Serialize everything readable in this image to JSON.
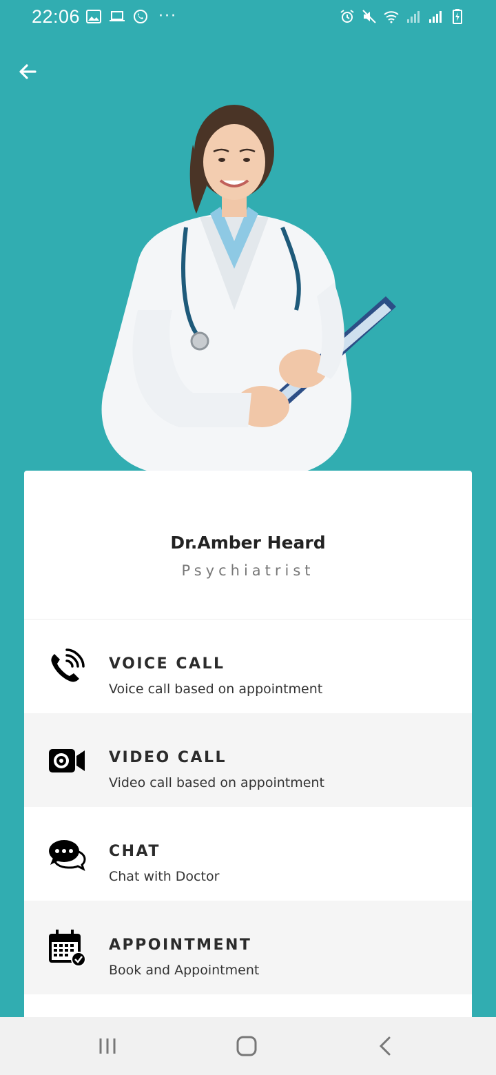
{
  "status_bar": {
    "time": "22:06",
    "left_icons": [
      "image-icon",
      "laptop-icon",
      "whatsapp-icon",
      "more-dots-icon"
    ],
    "right_icons": [
      "alarm-icon",
      "mute-icon",
      "wifi-icon",
      "signal-icon",
      "signal-icon",
      "battery-charging-icon"
    ],
    "more_dots": "···"
  },
  "header": {
    "back_icon": "arrow-left-icon"
  },
  "doctor": {
    "name": "Dr.Amber Heard",
    "specialty": "Psychiatrist"
  },
  "options": [
    {
      "title": "VOICE CALL",
      "subtitle": "Voice call based on appointment",
      "icon": "phone-call-icon"
    },
    {
      "title": "VIDEO CALL",
      "subtitle": "Video call based on appointment",
      "icon": "video-camera-icon"
    },
    {
      "title": "CHAT",
      "subtitle": "Chat with Doctor",
      "icon": "chat-bubbles-icon"
    },
    {
      "title": "APPOINTMENT",
      "subtitle": "Book and Appointment",
      "icon": "calendar-check-icon"
    }
  ],
  "nav_bar": {
    "buttons": [
      "recent-apps-icon",
      "home-icon",
      "back-icon"
    ]
  },
  "colors": {
    "background": "#31adb1",
    "card": "#ffffff",
    "alt_row": "#f5f5f5",
    "text": "#2b2b2b"
  }
}
